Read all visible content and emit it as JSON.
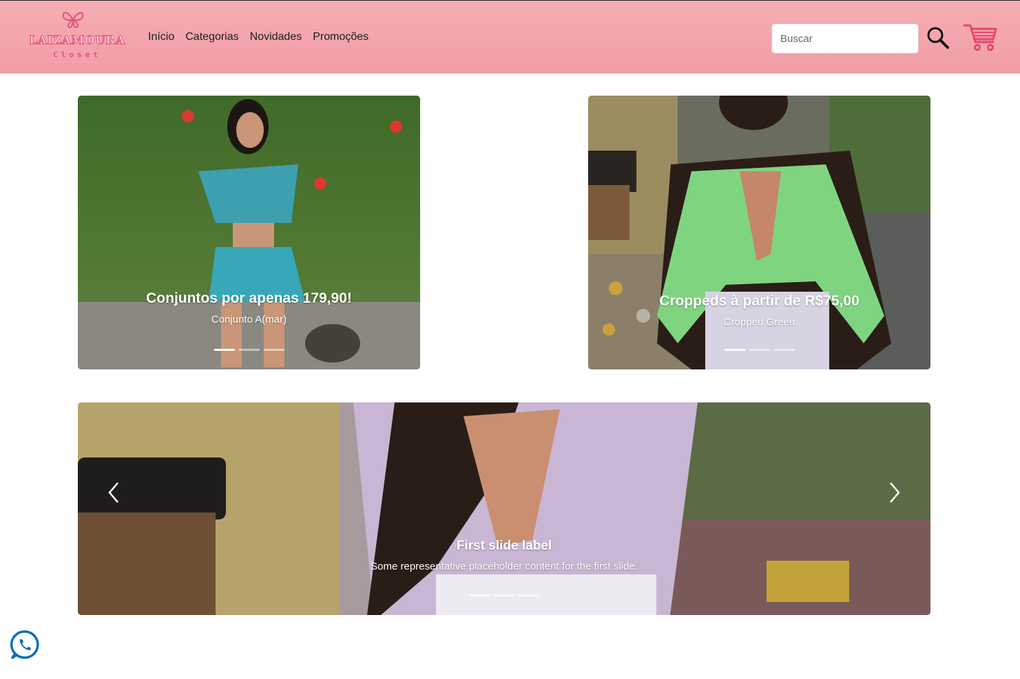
{
  "brand": {
    "logo_word": "LAIZAMOURA",
    "logo_sub": "Closet",
    "colors": {
      "header": "#f3a6ad",
      "accent": "#e5517e"
    }
  },
  "nav": {
    "items": [
      {
        "label": "Início"
      },
      {
        "label": "Categorias"
      },
      {
        "label": "Novidades"
      },
      {
        "label": "Promoções"
      }
    ]
  },
  "search": {
    "placeholder": "Buscar",
    "value": "",
    "icon": "search-icon"
  },
  "cart": {
    "icon": "shopping-cart-icon"
  },
  "carousels": [
    {
      "title": "Conjuntos por apenas 179,90!",
      "text": "Conjunto A(mar)",
      "indicators": 3,
      "active_index": 0
    },
    {
      "title": "Croppeds à partir de R$75,00",
      "text": "Cropped Green",
      "indicators": 3,
      "active_index": 0
    },
    {
      "title": "First slide label",
      "text": "Some representative placeholder content for the first slide.",
      "indicators": 3,
      "active_index": 0,
      "prev_icon": "chevron-left-icon",
      "next_icon": "chevron-right-icon"
    }
  ],
  "whatsapp": {
    "icon": "whatsapp-icon"
  }
}
